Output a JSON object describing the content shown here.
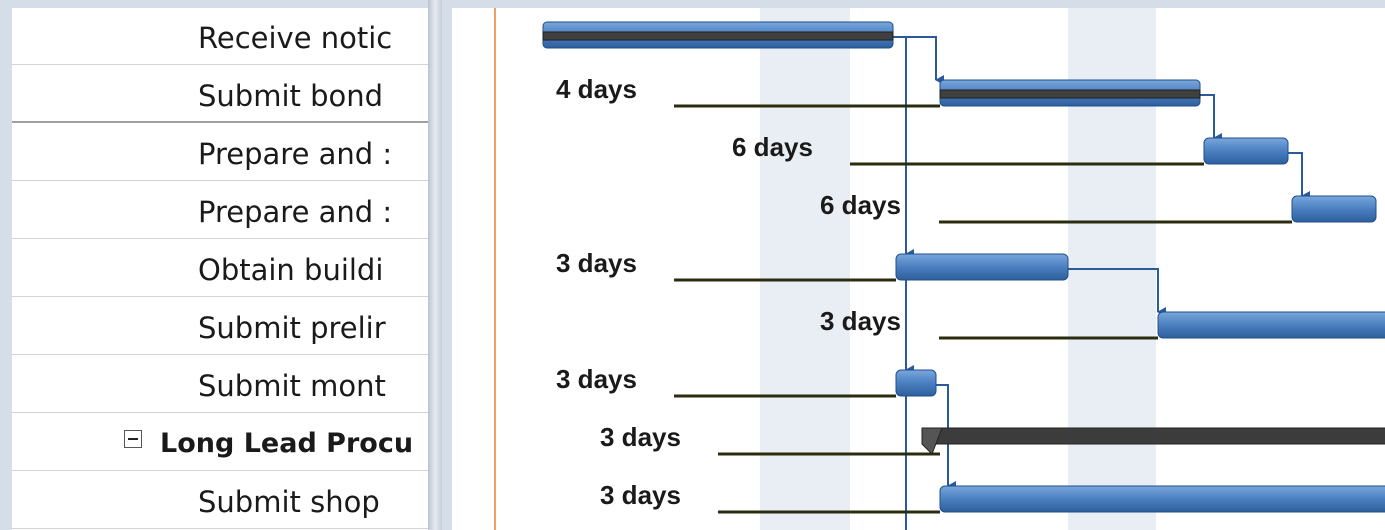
{
  "tasks": [
    {
      "name": "Receive notic"
    },
    {
      "name": "Submit bond"
    },
    {
      "name": "Prepare and :"
    },
    {
      "name": "Prepare and :"
    },
    {
      "name": "Obtain buildi"
    },
    {
      "name": "Submit prelir"
    },
    {
      "name": "Submit mont"
    },
    {
      "name": "Long Lead Procu"
    },
    {
      "name": "Submit shop"
    }
  ],
  "gantt": {
    "slack_labels": [
      "4 days",
      "6 days",
      "6 days",
      "3 days",
      "3 days",
      "3 days",
      "3 days",
      "3 days"
    ]
  },
  "colors": {
    "bar": "#4a7fc0",
    "summary_bar": "#3c3c3c",
    "slack_line": "#2b2b10",
    "link": "#2a5a9a",
    "today_line": "#f0a060"
  }
}
